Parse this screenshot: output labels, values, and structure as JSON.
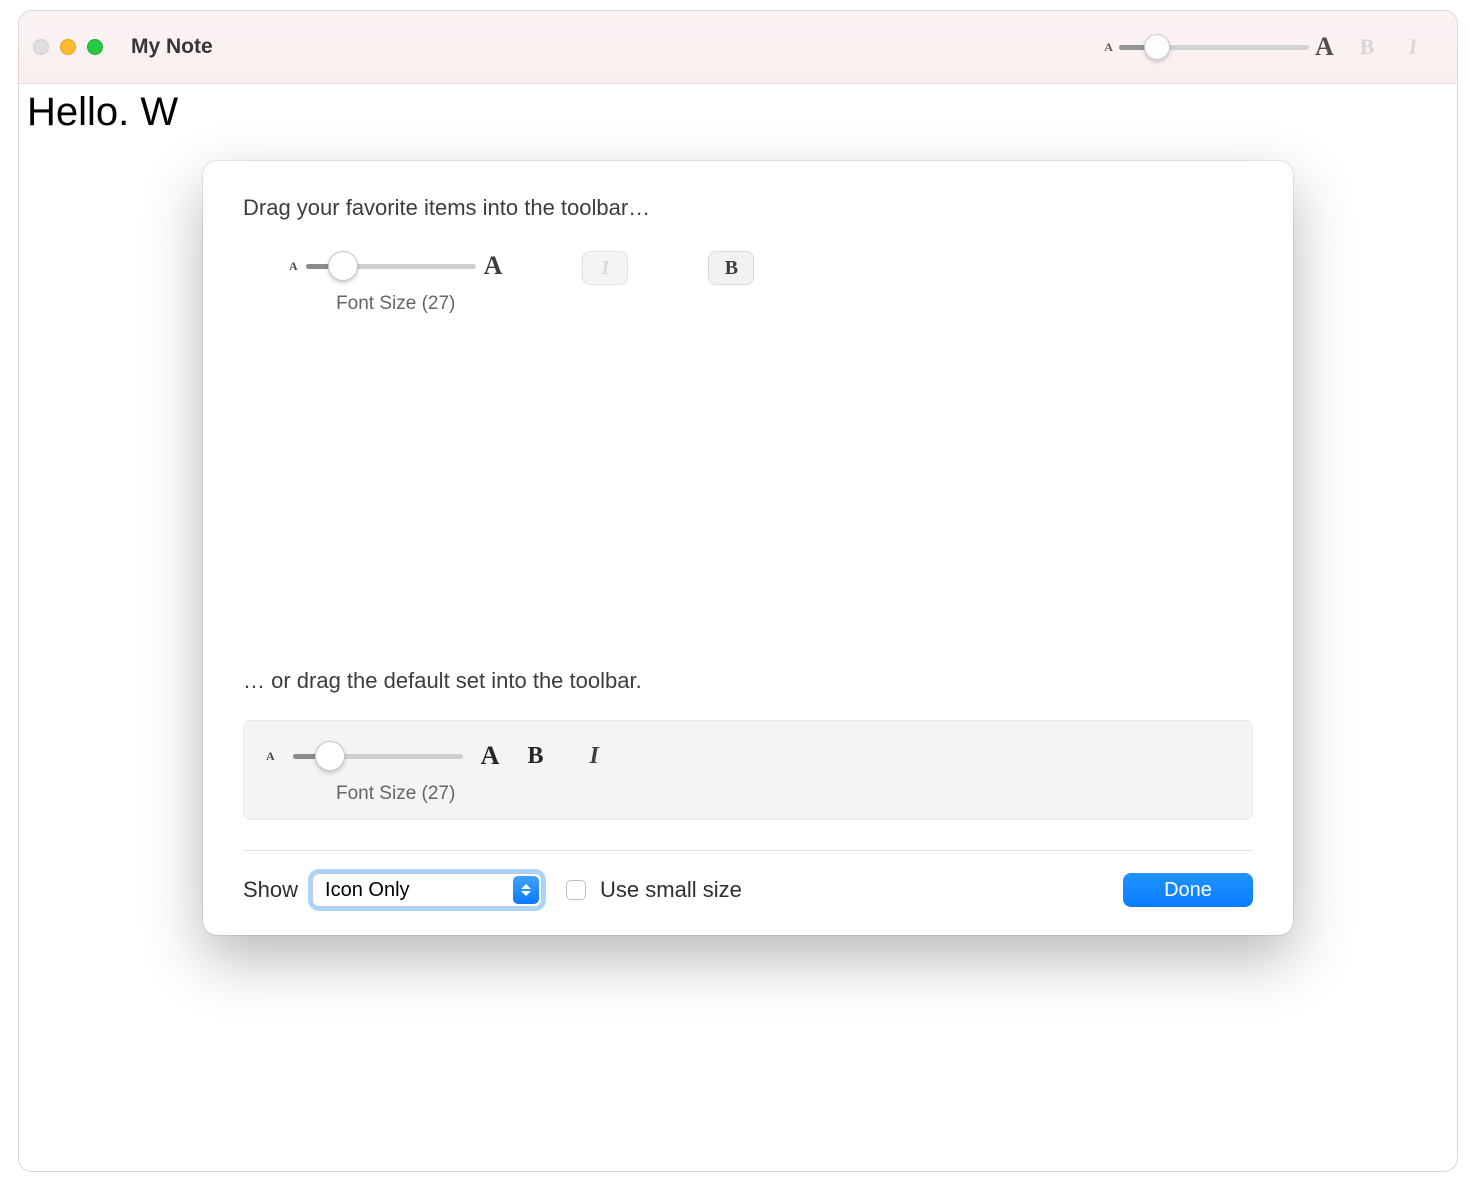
{
  "window": {
    "title": "My Note",
    "content_text": "Hello. W"
  },
  "toolbar": {
    "slider": {
      "min_label": "A",
      "max_label": "A",
      "fill_pct": 20
    }
  },
  "customize": {
    "heading": "Drag your favorite items into the toolbar…",
    "palette": {
      "font_size": {
        "min_label": "A",
        "max_label": "A",
        "label": "Font Size (27)",
        "fill_pct": 22
      },
      "italic_glyph": "I",
      "bold_glyph": "B"
    },
    "default_heading": "… or drag the default set into the toolbar.",
    "default_set": {
      "font_size": {
        "min_label": "A",
        "max_label": "A",
        "label": "Font Size (27)",
        "fill_pct": 22
      },
      "bold_glyph": "B",
      "italic_glyph": "I"
    },
    "footer": {
      "show_label": "Show",
      "show_value": "Icon Only",
      "use_small_label": "Use small size",
      "done_label": "Done"
    }
  }
}
